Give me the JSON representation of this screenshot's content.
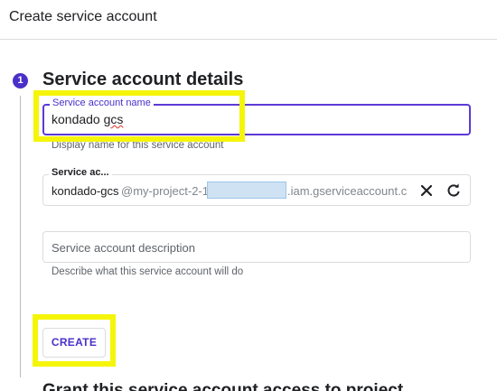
{
  "header": {
    "title": "Create service account"
  },
  "step": {
    "number": "1",
    "title": "Service account details",
    "next_title": "Grant this service account access to project"
  },
  "fields": {
    "name": {
      "label": "Service account name",
      "value_prefix": "kondado",
      "value_suffix": "gcs",
      "hint": "Display name for this service account"
    },
    "id": {
      "label": "Service ac...",
      "value": "kondado-gcs",
      "suffix_part1": "@my-project-2-1",
      "suffix_part2": ".iam.gserviceaccount.c",
      "clear_icon": "close-icon",
      "refresh_icon": "refresh-icon"
    },
    "description": {
      "placeholder": "Service account description",
      "hint": "Describe what this service account will do"
    }
  },
  "actions": {
    "create_label": "CREATE"
  },
  "colors": {
    "accent": "#4a2fc9",
    "focus_border": "#5c39d6",
    "highlight": "#f5f50a",
    "redaction": "#cfe2f3"
  }
}
